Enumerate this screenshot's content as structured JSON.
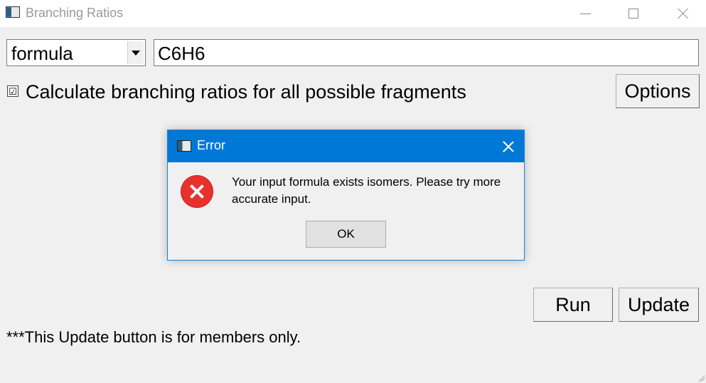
{
  "window": {
    "title": "Branching Ratios"
  },
  "input_type": {
    "selected": "formula"
  },
  "formula": {
    "value": "C6H6"
  },
  "checkbox": {
    "checked": true,
    "mark": "☑",
    "label": "Calculate branching ratios for all possible fragments"
  },
  "buttons": {
    "options": "Options",
    "run": "Run",
    "update": "Update"
  },
  "note": "***This Update button is for members only.",
  "dialog": {
    "title": "Error",
    "message": "Your input formula exists isomers. Please try more accurate input.",
    "ok": "OK",
    "icon": "error-icon"
  },
  "colors": {
    "dialog_titlebar": "#0078d7",
    "error_icon": "#e8312c"
  }
}
